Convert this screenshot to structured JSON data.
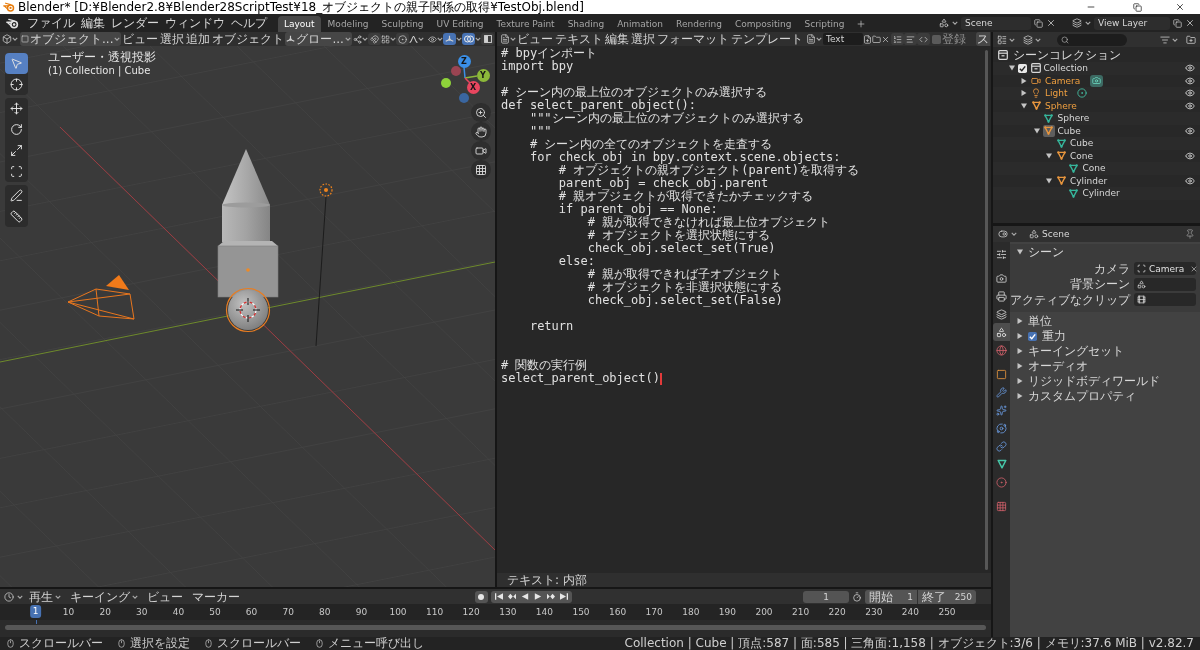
{
  "window": {
    "title": "Blender* [D:¥Blender2.8¥Blender28ScriptTest¥18_オブジェクトの親子関係の取得¥TestObj.blend]"
  },
  "top_bar": {
    "menus": [
      "ファイル",
      "編集",
      "レンダー",
      "ウィンドウ",
      "ヘルプ"
    ],
    "workspaces": [
      {
        "label": "Layout",
        "selected": true
      },
      {
        "label": "Modeling",
        "selected": false
      },
      {
        "label": "Sculpting",
        "selected": false
      },
      {
        "label": "UV Editing",
        "selected": false
      },
      {
        "label": "Texture Paint",
        "selected": false
      },
      {
        "label": "Shading",
        "selected": false
      },
      {
        "label": "Animation",
        "selected": false
      },
      {
        "label": "Rendering",
        "selected": false
      },
      {
        "label": "Compositing",
        "selected": false
      },
      {
        "label": "Scripting",
        "selected": false
      }
    ],
    "scene": "Scene",
    "view_layer": "View Layer"
  },
  "viewport": {
    "mode": "オブジェクト...",
    "menus": [
      "ビュー",
      "選択",
      "追加",
      "オブジェクト"
    ],
    "orientation": "グロー...",
    "snapping_toggles": [
      {
        "kind": "snap",
        "on": false
      },
      {
        "kind": "proportional",
        "on": false
      }
    ],
    "display_toggles": [
      {
        "kind": "gizmo",
        "on": true
      },
      {
        "kind": "overlay",
        "on": true
      },
      {
        "kind": "xray",
        "on": false
      }
    ],
    "view_name": "ユーザー・透視投影",
    "context": "(1) Collection | Cube",
    "tool_groups": [
      [
        {
          "kind": "select_box",
          "selected": true
        },
        {
          "kind": "cursor",
          "selected": false
        }
      ],
      [
        {
          "kind": "move",
          "selected": false
        },
        {
          "kind": "rotate",
          "selected": false
        },
        {
          "kind": "scale",
          "selected": false
        },
        {
          "kind": "transform",
          "selected": false
        }
      ],
      [
        {
          "kind": "annotate",
          "selected": false
        },
        {
          "kind": "measure",
          "selected": false
        }
      ]
    ],
    "gizmo_axes": [
      {
        "label": "Z",
        "color": "#3b8fe6"
      },
      {
        "label": "Y",
        "color": "#8cb83a"
      },
      {
        "label": "X",
        "color": "#e8465f"
      }
    ]
  },
  "text_editor": {
    "menus": [
      "ビュー",
      "テキスト",
      "編集",
      "選択",
      "フォーマット",
      "テンプレート"
    ],
    "text_name": "Text",
    "toggles": [
      {
        "kind": "line_numbers",
        "on": false
      },
      {
        "kind": "word_wrap",
        "on": false
      },
      {
        "kind": "syntax",
        "on": false
      }
    ],
    "register": {
      "label": "登録",
      "checked": false
    },
    "run": "ス",
    "code": "# bpyインポート\nimport bpy\n\n# シーン内の最上位のオブジェクトのみ選択する\ndef select_parent_object():\n    \"\"\"シーン内の最上位のオブジェクトのみ選択する\n    \"\"\"\n    # シーン内の全てのオブジェクトを走査する\n    for check_obj in bpy.context.scene.objects:\n        # オブジェクトの親オブジェクト(parent)を取得する\n        parent_obj = check_obj.parent\n        # 親オブジェクトが取得できたかチェックする\n        if parent_obj == None:\n            # 親が取得できなければ最上位オブジェクト\n            # オブジェクトを選択状態にする\n            check_obj.select_set(True)\n        else:\n            # 親が取得できれば子オブジェクト\n            # オブジェクトを非選択状態にする\n            check_obj.select_set(False)\n\n    return\n\n\n# 関数の実行例\nselect_parent_object()",
    "footer": "テキスト: 内部"
  },
  "outliner": {
    "root": "シーンコレクション",
    "tree": [
      {
        "name": "Collection",
        "kind": "collection",
        "checked": true,
        "expanded": true,
        "visible": true,
        "children": [
          {
            "name": "Camera",
            "kind": "camera",
            "selected": true,
            "active": false,
            "expanded": false,
            "visible": true
          },
          {
            "name": "Light",
            "kind": "light",
            "selected": true,
            "active": false,
            "expanded": false,
            "visible": true
          },
          {
            "name": "Sphere",
            "kind": "mesh_object",
            "selected": true,
            "active": false,
            "expanded": true,
            "visible": true,
            "children": [
              {
                "name": "Sphere",
                "kind": "mesh_data"
              },
              {
                "name": "Cube",
                "kind": "mesh_object",
                "selected": false,
                "active": true,
                "expanded": true,
                "visible": true,
                "children": [
                  {
                    "name": "Cube",
                    "kind": "mesh_data"
                  },
                  {
                    "name": "Cone",
                    "kind": "mesh_object",
                    "selected": false,
                    "active": false,
                    "expanded": true,
                    "visible": true,
                    "children": [
                      {
                        "name": "Cone",
                        "kind": "mesh_data"
                      }
                    ]
                  },
                  {
                    "name": "Cylinder",
                    "kind": "mesh_object",
                    "selected": false,
                    "active": false,
                    "expanded": true,
                    "visible": true,
                    "children": [
                      {
                        "name": "Cylinder",
                        "kind": "mesh_data"
                      }
                    ]
                  }
                ]
              }
            ]
          }
        ]
      }
    ]
  },
  "properties": {
    "context": "Scene",
    "tab_groups": [
      [
        {
          "kind": "tool",
          "selected": false
        }
      ],
      [
        {
          "kind": "render",
          "selected": false
        },
        {
          "kind": "output",
          "selected": false
        },
        {
          "kind": "view_layer",
          "selected": false
        },
        {
          "kind": "scene",
          "selected": true
        },
        {
          "kind": "world",
          "selected": false
        }
      ],
      [
        {
          "kind": "object",
          "selected": false
        },
        {
          "kind": "modifiers",
          "selected": false
        },
        {
          "kind": "particles",
          "selected": false
        },
        {
          "kind": "physics",
          "selected": false
        },
        {
          "kind": "constraints",
          "selected": false
        },
        {
          "kind": "data",
          "selected": false
        },
        {
          "kind": "material",
          "selected": false
        }
      ],
      [
        {
          "kind": "texture",
          "selected": false
        }
      ]
    ],
    "panels": [
      {
        "title": "シーン",
        "kind": "panel",
        "expanded": true,
        "fields": [
          {
            "label": "カメラ",
            "kind": "camera",
            "value": "Camera"
          },
          {
            "label": "背景シーン",
            "kind": "scene"
          },
          {
            "label": "アクティブなクリップ",
            "kind": "clip"
          }
        ]
      },
      {
        "title": "単位",
        "kind": "panel",
        "expanded": false
      },
      {
        "title": "重力",
        "kind": "toggle_panel",
        "expanded": false,
        "checked": true
      },
      {
        "title": "キーイングセット",
        "kind": "panel",
        "expanded": false
      },
      {
        "title": "オーディオ",
        "kind": "panel",
        "expanded": false
      },
      {
        "title": "リジッドボディワールド",
        "kind": "panel",
        "expanded": false
      },
      {
        "title": "カスタムプロパティ",
        "kind": "panel",
        "expanded": false
      }
    ]
  },
  "timeline": {
    "menus": [
      {
        "label": "再生",
        "kind": "dropdown"
      },
      {
        "label": "キーイング",
        "kind": "dropdown"
      },
      {
        "label": "ビュー",
        "kind": "menu"
      },
      {
        "label": "マーカー",
        "kind": "menu"
      }
    ],
    "current_frame": "1",
    "start": {
      "label": "開始",
      "value": "1"
    },
    "end": {
      "label": "終了",
      "value": "250"
    },
    "ruler": {
      "current": "1",
      "labels": [
        "10",
        "20",
        "30",
        "40",
        "50",
        "60",
        "70",
        "80",
        "90",
        "100",
        "110",
        "120",
        "130",
        "140",
        "150",
        "160",
        "170",
        "180",
        "190",
        "200",
        "210",
        "220",
        "230",
        "240",
        "250"
      ]
    }
  },
  "status_bar": {
    "hints": [
      "スクロールバー",
      "選択を設定",
      "スクロールバー",
      "メニュー呼び出し"
    ],
    "stats": "Collection | Cube | 頂点:587 | 面:585 | 三角面:1,158 | オブジェクト:3/6 | メモリ:37.6 MiB | v2.82.7"
  }
}
